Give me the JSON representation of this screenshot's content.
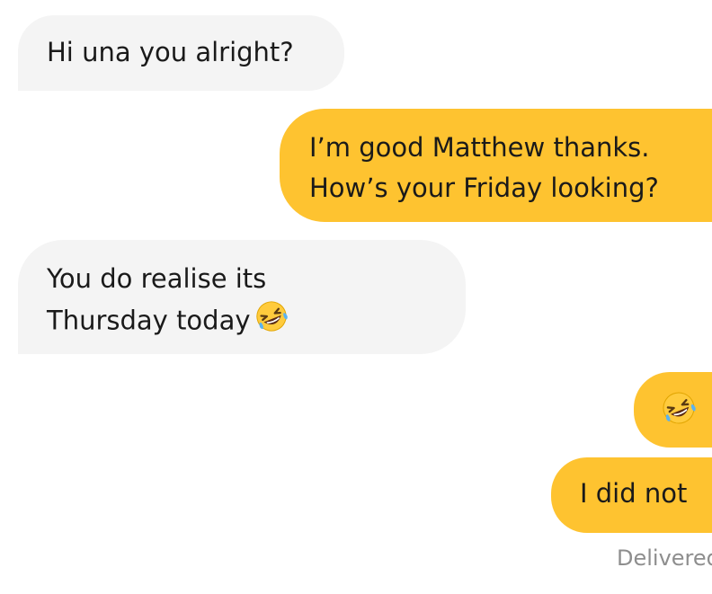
{
  "conversation": {
    "messages": [
      {
        "direction": "incoming",
        "lines": [
          "Hi una you alright?"
        ]
      },
      {
        "direction": "outgoing",
        "lines": [
          "I’m good Matthew thanks.",
          "How’s your Friday looking?"
        ]
      },
      {
        "direction": "incoming",
        "lines": [
          "You do realise its",
          "Thursday today"
        ],
        "emoji": "rolling-on-floor-laughing-emoji"
      },
      {
        "direction": "outgoing",
        "lines": [],
        "emoji": "rolling-on-floor-laughing-emoji"
      },
      {
        "direction": "outgoing",
        "lines": [
          "I did not"
        ]
      }
    ],
    "status": "Delivered"
  },
  "colors": {
    "incoming_bubble": "#f4f4f4",
    "outgoing_bubble": "#fec330",
    "text": "#1a1a1a",
    "status_text": "#8e8e8e"
  }
}
